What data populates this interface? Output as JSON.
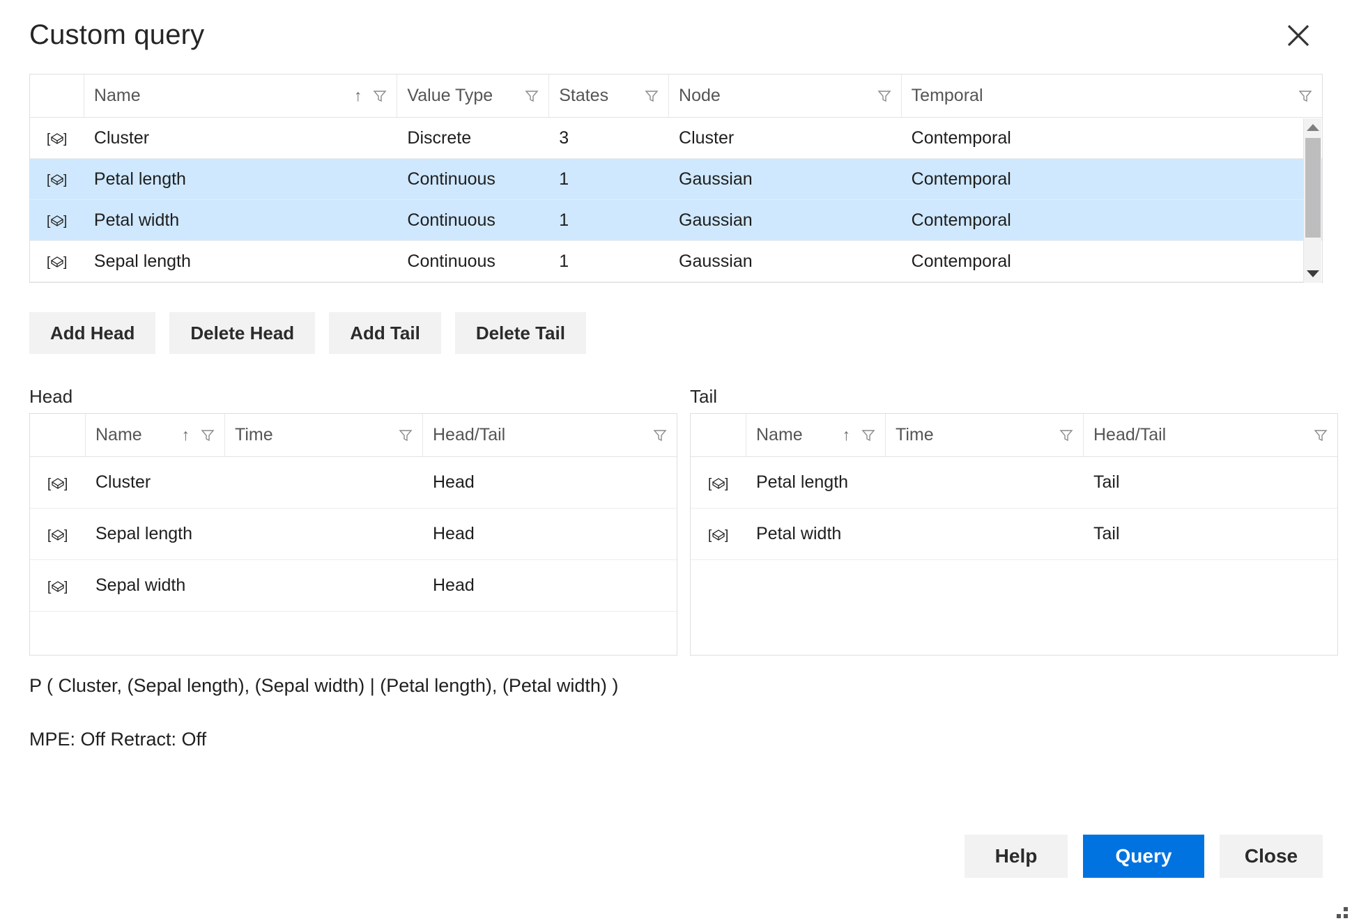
{
  "dialog": {
    "title": "Custom query",
    "close_icon": "close-icon"
  },
  "variables_table": {
    "columns": [
      {
        "key": "icon",
        "label": ""
      },
      {
        "key": "name",
        "label": "Name"
      },
      {
        "key": "value_type",
        "label": "Value Type"
      },
      {
        "key": "states",
        "label": "States"
      },
      {
        "key": "node",
        "label": "Node"
      },
      {
        "key": "temporal",
        "label": "Temporal"
      }
    ],
    "sort_indicator": "↑",
    "rows": [
      {
        "name": "Cluster",
        "value_type": "Discrete",
        "states": "3",
        "node": "Cluster",
        "temporal": "Contemporal",
        "selected": false
      },
      {
        "name": "Petal length",
        "value_type": "Continuous",
        "states": "1",
        "node": "Gaussian",
        "temporal": "Contemporal",
        "selected": true
      },
      {
        "name": "Petal width",
        "value_type": "Continuous",
        "states": "1",
        "node": "Gaussian",
        "temporal": "Contemporal",
        "selected": true
      },
      {
        "name": "Sepal length",
        "value_type": "Continuous",
        "states": "1",
        "node": "Gaussian",
        "temporal": "Contemporal",
        "selected": false
      }
    ]
  },
  "action_buttons": [
    {
      "label": "Add Head"
    },
    {
      "label": "Delete Head"
    },
    {
      "label": "Add Tail"
    },
    {
      "label": "Delete Tail"
    }
  ],
  "head_panel": {
    "label": "Head",
    "columns": [
      {
        "key": "icon",
        "label": ""
      },
      {
        "key": "name",
        "label": "Name"
      },
      {
        "key": "time",
        "label": "Time"
      },
      {
        "key": "head_tail",
        "label": "Head/Tail"
      }
    ],
    "sort_indicator": "↑",
    "rows": [
      {
        "name": "Cluster",
        "time": "",
        "head_tail": "Head"
      },
      {
        "name": "Sepal length",
        "time": "",
        "head_tail": "Head"
      },
      {
        "name": "Sepal width",
        "time": "",
        "head_tail": "Head"
      }
    ]
  },
  "tail_panel": {
    "label": "Tail",
    "columns": [
      {
        "key": "icon",
        "label": ""
      },
      {
        "key": "name",
        "label": "Name"
      },
      {
        "key": "time",
        "label": "Time"
      },
      {
        "key": "head_tail",
        "label": "Head/Tail"
      }
    ],
    "sort_indicator": "↑",
    "rows": [
      {
        "name": "Petal length",
        "time": "",
        "head_tail": "Tail"
      },
      {
        "name": "Petal width",
        "time": "",
        "head_tail": "Tail"
      }
    ]
  },
  "expression": "P ( Cluster, (Sepal length), (Sepal width) | (Petal length), (Petal width) )",
  "flags": "MPE: Off  Retract: Off",
  "footer": {
    "help_label": "Help",
    "query_label": "Query",
    "close_label": "Close"
  },
  "colors": {
    "selected_row": "#cfe8fd",
    "primary_button": "#0073e0",
    "button_face": "#f2f2f2",
    "border": "#dfdfdf"
  }
}
